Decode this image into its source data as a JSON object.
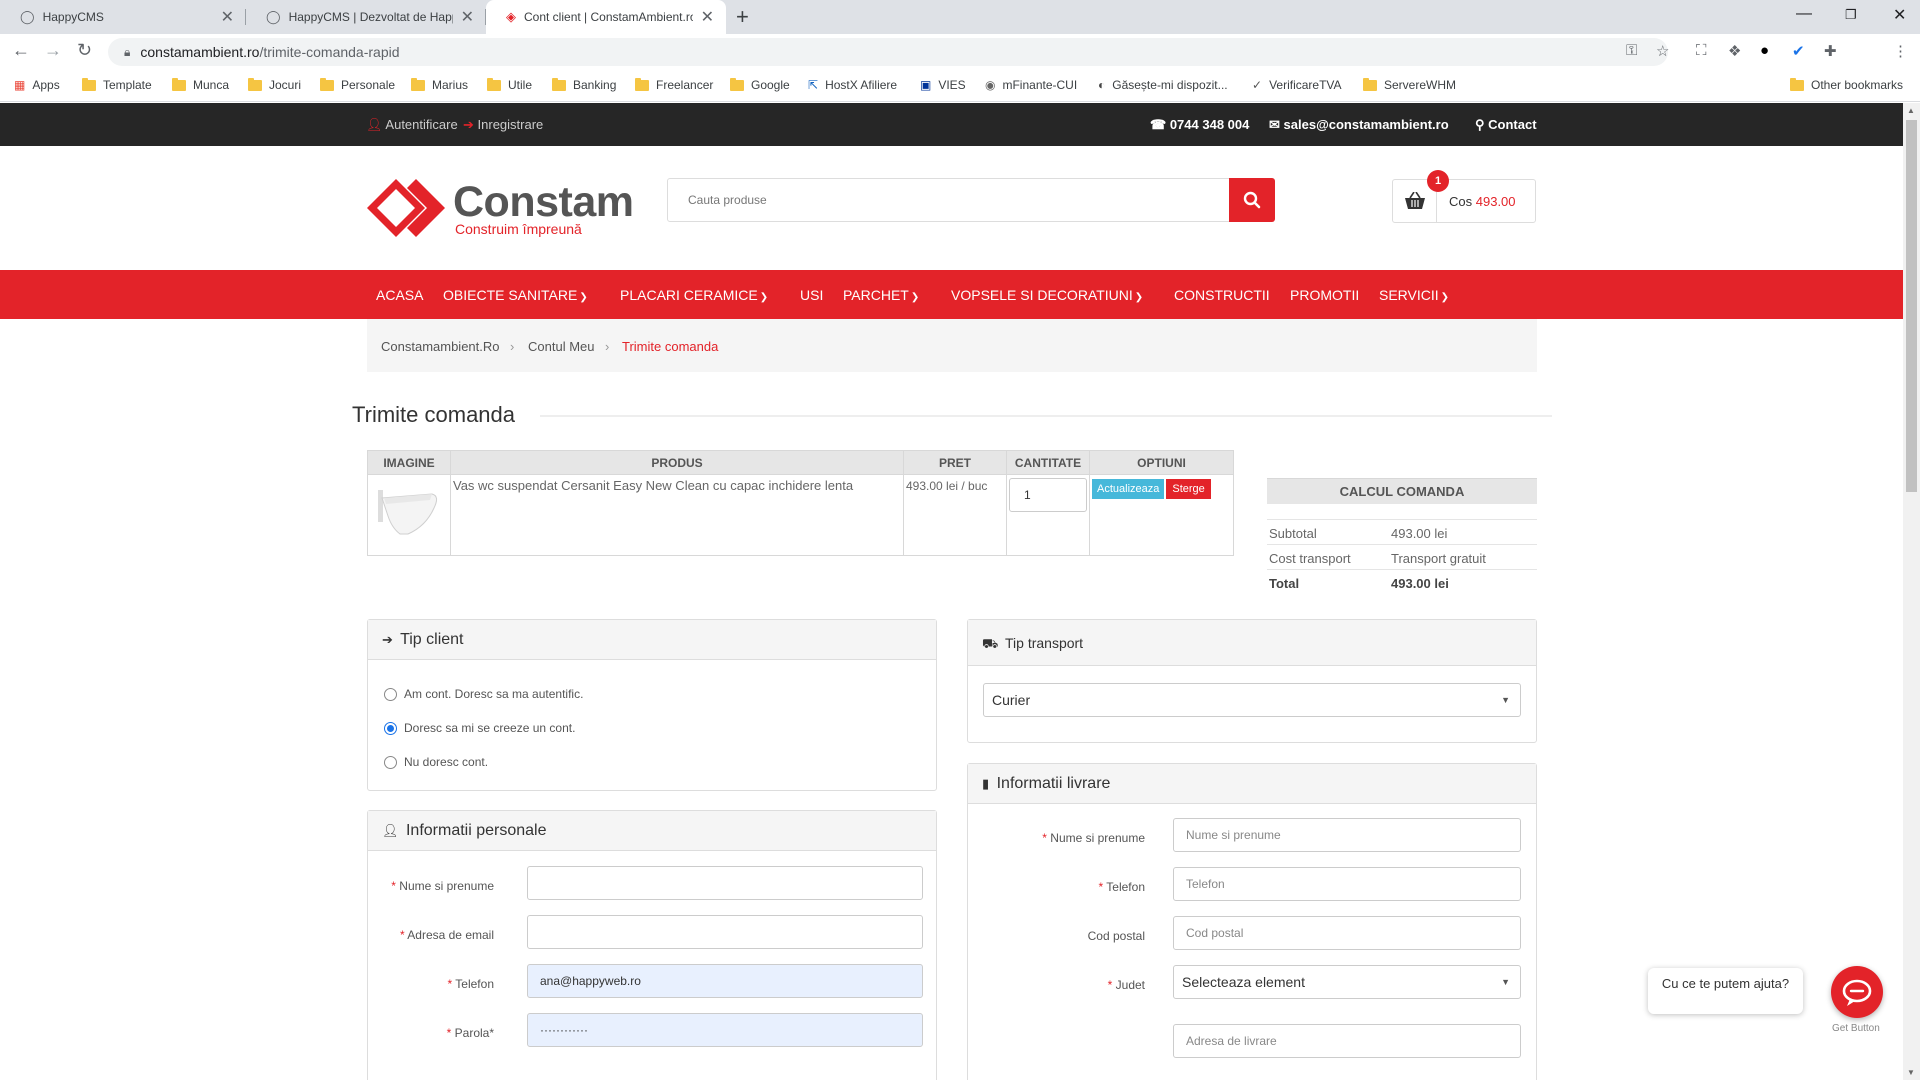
{
  "browser": {
    "tabs": [
      {
        "title": "HappyCMS",
        "active": false
      },
      {
        "title": "HappyCMS | Dezvoltat de Happy",
        "active": false
      },
      {
        "title": "Cont client | ConstamAmbient.ro",
        "active": true
      }
    ],
    "url_host": "constamambient.ro",
    "url_path": "/trimite-comanda-rapid",
    "bookmarks": [
      "Apps",
      "Template",
      "Munca",
      "Jocuri",
      "Personale",
      "Marius",
      "Utile",
      "Banking",
      "Freelancer",
      "Google",
      "HostX Afiliere",
      "VIES",
      "mFinante-CUI",
      "Găsește-mi dispozit...",
      "VerificareTVA",
      "ServereWHM"
    ],
    "other_bookmarks": "Other bookmarks"
  },
  "topbar": {
    "login": "Autentificare",
    "register": "Inregistrare",
    "phone": "0744 348 004",
    "email": "sales@constamambient.ro",
    "contact": "Contact"
  },
  "header": {
    "logo_name": "Constam",
    "logo_tagline": "Construim împreună",
    "search_placeholder": "Cauta produse",
    "cart_count": "1",
    "cart_label": "Cos",
    "cart_total": "493.00"
  },
  "nav": [
    "ACASA",
    "OBIECTE SANITARE",
    "PLACARI CERAMICE",
    "USI",
    "PARCHET",
    "VOPSELE SI DECORATIUNI",
    "CONSTRUCTII",
    "PROMOTII",
    "SERVICII"
  ],
  "breadcrumb": [
    "Constamambient.Ro",
    "Contul Meu",
    "Trimite comanda"
  ],
  "page_title": "Trimite comanda",
  "cart_table": {
    "headers": [
      "IMAGINE",
      "PRODUS",
      "PRET",
      "CANTITATE",
      "OPTIUNI"
    ],
    "rows": [
      {
        "product": "Vas wc suspendat Cersanit Easy New Clean cu capac inchidere lenta",
        "price": "493.00 lei / buc",
        "qty": "1",
        "update": "Actualizeaza",
        "delete": "Sterge"
      }
    ]
  },
  "summary": {
    "title": "CALCUL COMANDA",
    "rows": [
      {
        "label": "Subtotal",
        "value": "493.00 lei"
      },
      {
        "label": "Cost transport",
        "value": "Transport gratuit"
      },
      {
        "label": "Total",
        "value": "493.00 lei"
      }
    ]
  },
  "tip_client": {
    "title": "Tip client",
    "options": [
      "Am cont. Doresc sa ma autentific.",
      "Doresc sa mi se creeze un cont.",
      "Nu doresc cont."
    ],
    "selected": 1
  },
  "tip_transport": {
    "title": "Tip transport",
    "value": "Curier"
  },
  "info_personale": {
    "title": "Informatii personale",
    "fields": [
      {
        "label": "Nume si prenume",
        "value": ""
      },
      {
        "label": "Adresa de email",
        "value": ""
      },
      {
        "label": "Telefon",
        "value": "ana@happyweb.ro"
      },
      {
        "label": "Parola*",
        "value": "············"
      }
    ]
  },
  "info_livrare": {
    "title": "Informatii livrare",
    "fields": [
      {
        "label": "Nume si prenume",
        "placeholder": "Nume si prenume"
      },
      {
        "label": "Telefon",
        "placeholder": "Telefon"
      },
      {
        "label": "Cod postal",
        "placeholder": "Cod postal"
      },
      {
        "label": "Judet",
        "value": "Selecteaza element"
      },
      {
        "label": "",
        "placeholder": "Adresa de livrare"
      }
    ]
  },
  "chat": {
    "bubble": "Cu ce te putem ajuta?",
    "caption": "Get Button"
  },
  "colors": {
    "brand_red": "#e32329",
    "topbar": "#262626",
    "update_blue": "#46b8da"
  }
}
